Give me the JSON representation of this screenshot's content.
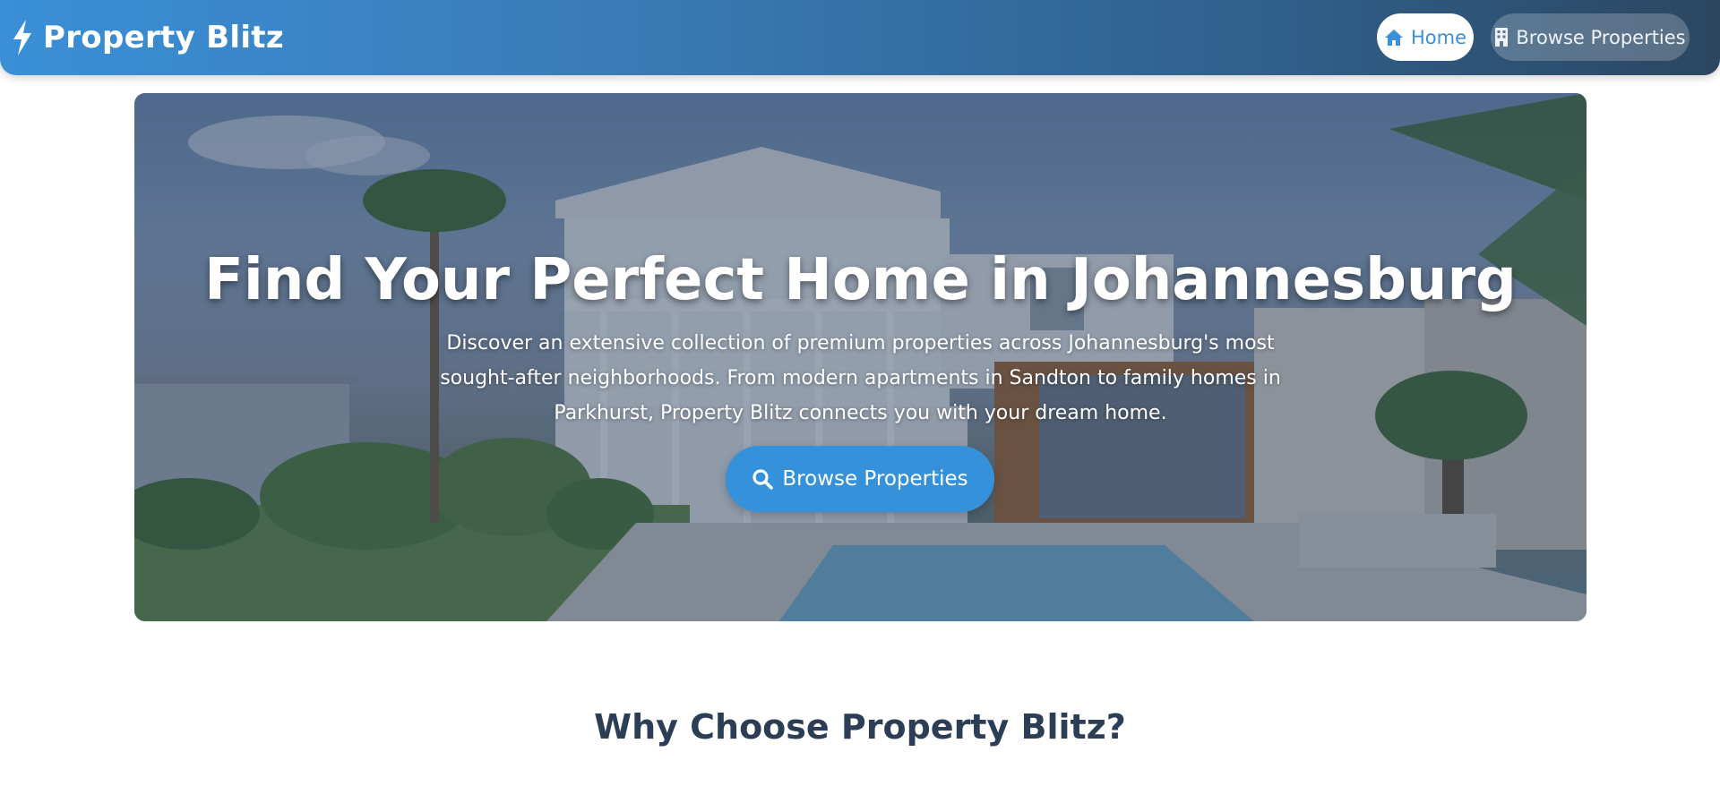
{
  "header": {
    "brand": "Property Blitz",
    "nav": {
      "home_label": "Home",
      "browse_label": "Browse Properties"
    }
  },
  "hero": {
    "title": "Find Your Perfect Home in Johannesburg",
    "subtitle": "Discover an extensive collection of premium properties across Johannesburg's most sought-after neighborhoods. From modern apartments in Sandton to family homes in Parkhurst, Property Blitz connects you with your dream home.",
    "cta_label": "Browse Properties"
  },
  "features": {
    "title": "Why Choose Property Blitz?"
  },
  "colors": {
    "primary": "#3592da",
    "header_start": "#3a8fd6",
    "header_end": "#2c4660",
    "heading_text": "#2c3e55"
  },
  "icons": {
    "brand": "bolt-icon",
    "home": "home-icon",
    "browse": "building-icon",
    "search": "search-icon"
  }
}
